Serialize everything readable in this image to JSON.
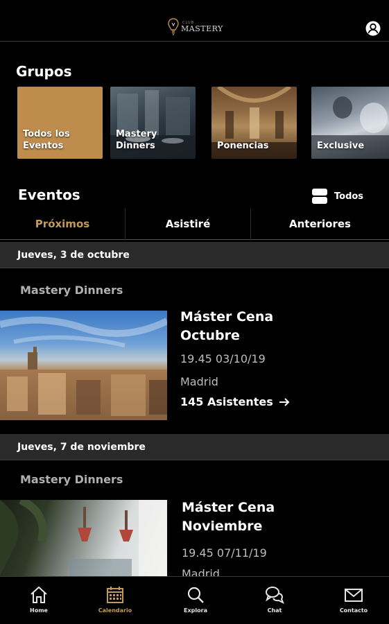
{
  "header": {
    "logo_small": "CLUB",
    "logo_main": "MASTERY"
  },
  "groups": {
    "title": "Grupos",
    "items": [
      {
        "label": "Todos los Eventos"
      },
      {
        "label": "Mastery Dinners"
      },
      {
        "label": "Ponencias"
      },
      {
        "label": "Exclusive"
      }
    ]
  },
  "events": {
    "title": "Eventos",
    "filter_label": "Todos",
    "tabs": [
      {
        "label": "Próximos",
        "active": true
      },
      {
        "label": "Asistiré",
        "active": false
      },
      {
        "label": "Anteriores",
        "active": false
      }
    ],
    "list": [
      {
        "date_header": "Jueves, 3 de octubre",
        "group": "Mastery Dinners",
        "title_line1": "Máster Cena",
        "title_line2": "Octubre",
        "datetime": "19.45  03/10/19",
        "city": "Madrid",
        "attendees": "145 Asistentes"
      },
      {
        "date_header": "Jueves, 7 de noviembre",
        "group": "Mastery Dinners",
        "title_line1": "Máster Cena",
        "title_line2": "Noviembre",
        "datetime": "19.45  07/11/19",
        "city": "Madrid"
      }
    ]
  },
  "bottom_nav": [
    {
      "label": "Home",
      "icon": "home-icon"
    },
    {
      "label": "Calendario",
      "icon": "calendar-icon",
      "active": true
    },
    {
      "label": "Explora",
      "icon": "search-icon"
    },
    {
      "label": "Chat",
      "icon": "chat-icon"
    },
    {
      "label": "Contacto",
      "icon": "mail-icon"
    }
  ],
  "colors": {
    "accent": "#c49a5a",
    "background": "#000000",
    "date_bar": "#2a2a2a"
  }
}
